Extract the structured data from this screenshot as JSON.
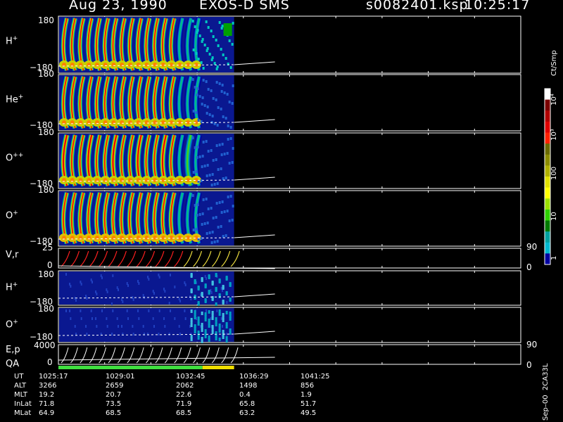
{
  "header": {
    "date": "Aug 23, 1990",
    "instrument": "EXOS-D SMS",
    "filename": "s0082401.ksp",
    "time": "10:25:17"
  },
  "colorbar": {
    "title": "Ct/Smp",
    "ticks": [
      "10⁴",
      "10³",
      "100",
      "10",
      "1"
    ],
    "colors": [
      "#ffffff",
      "#7a0000",
      "#b00000",
      "#e00000",
      "#ff2000",
      "#6a6a00",
      "#8c8c00",
      "#b0b000",
      "#e0e000",
      "#ffff00",
      "#9be000",
      "#2ed000",
      "#007a00",
      "#00a0a0",
      "#00b8d0",
      "#0000a0"
    ]
  },
  "panels": [
    {
      "label_main": "H",
      "label_sup": "+",
      "top": "180",
      "bottom": "−180"
    },
    {
      "label_main": "He",
      "label_sup": "+",
      "top": "180",
      "bottom": "−180"
    },
    {
      "label_main": "O",
      "label_sup": "++",
      "top": "180",
      "bottom": "−180"
    },
    {
      "label_main": "O",
      "label_sup": "+",
      "top": "180",
      "bottom": "−180"
    },
    {
      "label_main": "V,r",
      "label_sup": "",
      "top": "25",
      "bottom": "0",
      "right_top": "90",
      "right_bottom": "0"
    },
    {
      "label_main": "H",
      "label_sup": "+",
      "top": "180",
      "bottom": "−180"
    },
    {
      "label_main": "O",
      "label_sup": "+",
      "top": "180",
      "bottom": "−180"
    },
    {
      "label_main": "E,p",
      "label_sup": "",
      "top": "4000",
      "bottom": "0",
      "right_top": "90",
      "right_bottom": "0"
    }
  ],
  "qa_label": "QA",
  "footer": {
    "row_labels": [
      "UT",
      "ALT",
      "MLT",
      "InLat",
      "MLat"
    ],
    "columns": [
      [
        "1025:17",
        "3266",
        "19.2",
        "71.8",
        "64.9"
      ],
      [
        "1029:01",
        "2659",
        "20.7",
        "73.5",
        "68.5"
      ],
      [
        "1032:45",
        "2062",
        "22.6",
        "71.9",
        "68.5"
      ],
      [
        "1036:29",
        "1498",
        "0.4",
        "65.8",
        "63.2"
      ],
      [
        "1041:25",
        "856",
        "1.9",
        "51.7",
        "49.5"
      ]
    ],
    "side_text": "Sep–00  2CA33L"
  },
  "chart_data": {
    "type": "heatmap",
    "title": "Aug 23, 1990   EXOS-D SMS",
    "x_ticks": [
      "1025:17",
      "1029:01",
      "1032:45",
      "1036:29",
      "1041:25"
    ],
    "data_end_fraction": 0.38,
    "spin_cycles": 17,
    "panels": [
      {
        "name": "H+",
        "ylim": [
          -180,
          180
        ]
      },
      {
        "name": "He+",
        "ylim": [
          -180,
          180
        ]
      },
      {
        "name": "O++",
        "ylim": [
          -180,
          180
        ]
      },
      {
        "name": "O+",
        "ylim": [
          -180,
          180
        ]
      },
      {
        "name": "V,r",
        "ylim": [
          0,
          25
        ],
        "right_ylim": [
          0,
          90
        ]
      },
      {
        "name": "H+",
        "ylim": [
          -180,
          180
        ]
      },
      {
        "name": "O+",
        "ylim": [
          -180,
          180
        ]
      },
      {
        "name": "E,p",
        "ylim": [
          0,
          4000
        ],
        "right_ylim": [
          0,
          90
        ]
      }
    ]
  }
}
